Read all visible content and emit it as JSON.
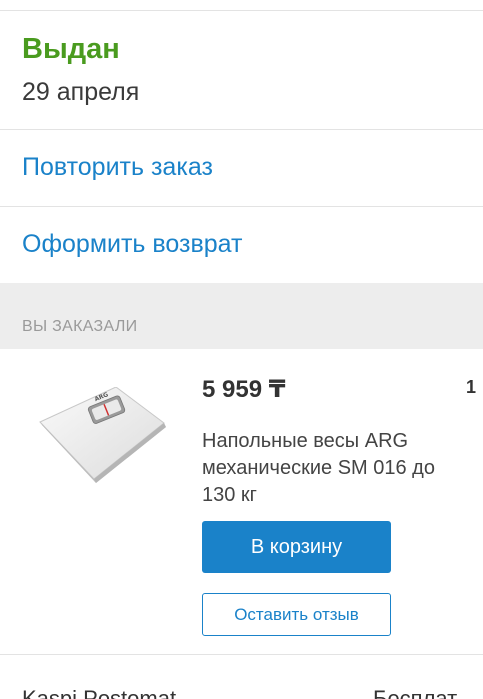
{
  "order": {
    "status": "Выдан",
    "date": "29 апреля"
  },
  "actions": {
    "repeat_label": "Повторить заказ",
    "return_label": "Оформить возврат"
  },
  "ordered_section": {
    "header": "ВЫ ЗАКАЗАЛИ"
  },
  "product": {
    "price": "5 959 ₸",
    "quantity": "1",
    "name": "Напольные весы ARG механические SM 016 до 130 кг",
    "image_label": "ARG",
    "cart_button": "В корзину",
    "review_button": "Оставить отзыв"
  },
  "delivery": {
    "left_text": "Kaspi Postomat",
    "right_text": "Бесплат"
  },
  "colors": {
    "status_green": "#4a9b1f",
    "accent_blue": "#1a82c9",
    "section_bg": "#ededed"
  }
}
